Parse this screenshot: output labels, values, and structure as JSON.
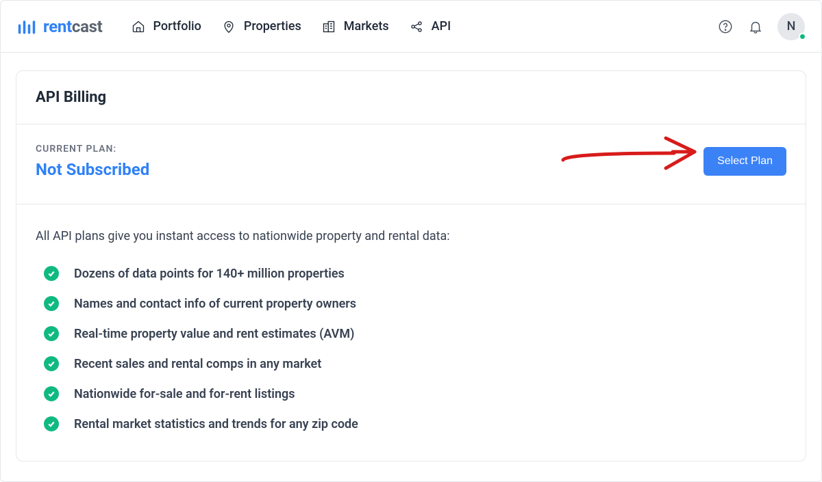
{
  "logo": {
    "part1": "rent",
    "part2": "cast"
  },
  "nav": {
    "portfolio": "Portfolio",
    "properties": "Properties",
    "markets": "Markets",
    "api": "API"
  },
  "avatar": {
    "initial": "N"
  },
  "card": {
    "title": "API Billing"
  },
  "plan": {
    "label": "CURRENT PLAN:",
    "name": "Not Subscribed",
    "button": "Select Plan"
  },
  "intro": "All API plans give you instant access to nationwide property and rental data:",
  "features": [
    "Dozens of data points for 140+ million properties",
    "Names and contact info of current property owners",
    "Real-time property value and rent estimates (AVM)",
    "Recent sales and rental comps in any market",
    "Nationwide for-sale and for-rent listings",
    "Rental market statistics and trends for any zip code"
  ]
}
